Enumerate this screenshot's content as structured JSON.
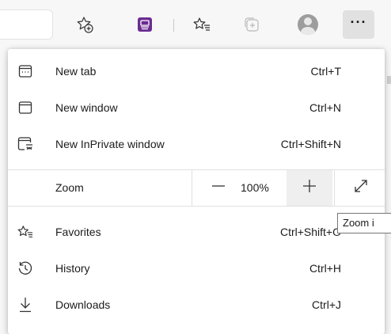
{
  "toolbar": {
    "buttons": [
      {
        "name": "add-to-favorites-icon"
      },
      {
        "name": "extension-icon"
      },
      {
        "name": "favorites-icon"
      },
      {
        "name": "collections-icon"
      },
      {
        "name": "profile-avatar-icon"
      },
      {
        "name": "more-options-icon",
        "label": "···"
      }
    ]
  },
  "menu": {
    "items": [
      {
        "label": "New tab",
        "shortcut": "Ctrl+T",
        "icon": "new-tab-icon"
      },
      {
        "label": "New window",
        "shortcut": "Ctrl+N",
        "icon": "new-window-icon"
      },
      {
        "label": "New InPrivate window",
        "shortcut": "Ctrl+Shift+N",
        "icon": "inprivate-icon"
      }
    ],
    "zoom": {
      "label": "Zoom",
      "decrease": "—",
      "value": "100%",
      "increase": "+",
      "fullscreen_icon": "fullscreen-icon"
    },
    "items2": [
      {
        "label": "Favorites",
        "shortcut": "Ctrl+Shift+O",
        "icon": "favorites-icon"
      },
      {
        "label": "History",
        "shortcut": "Ctrl+H",
        "icon": "history-icon"
      },
      {
        "label": "Downloads",
        "shortcut": "Ctrl+J",
        "icon": "downloads-icon"
      }
    ]
  },
  "tooltip": {
    "text": "Zoom i"
  },
  "colors": {
    "extension_accent": "#6b2c91",
    "menu_bg": "#ffffff",
    "toolbar_bg": "#f7f7f7"
  }
}
